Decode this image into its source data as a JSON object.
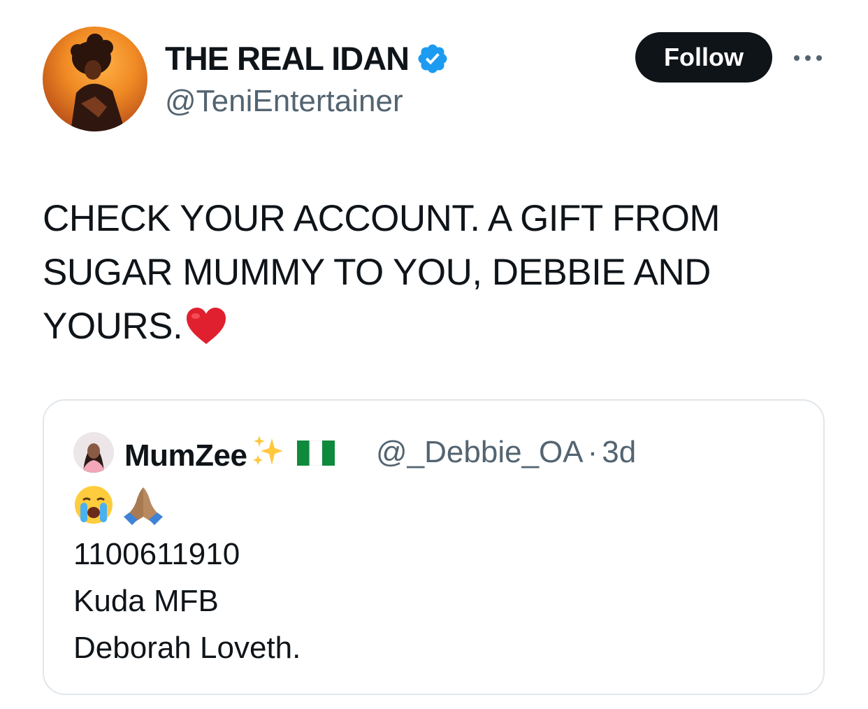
{
  "author": {
    "display_name": "THE REAL IDAN",
    "handle": "@TeniEntertainer",
    "verified": true
  },
  "actions": {
    "follow_label": "Follow"
  },
  "tweet": {
    "lines": [
      "CHECK YOUR ACCOUNT. A GIFT FROM",
      "SUGAR MUMMY TO YOU, DEBBIE AND",
      "YOURS."
    ]
  },
  "quoted_tweet": {
    "display_name": "MumZee",
    "handle": "@_Debbie_OA",
    "separator": "·",
    "age": "3d",
    "lines": [
      "1100611910",
      "Kuda MFB",
      "Deborah Loveth."
    ]
  },
  "colors": {
    "text": "#0f1419",
    "secondary": "#536471",
    "verified_blue": "#1d9bf0",
    "follow_bg": "#0f1419",
    "border": "#e1e6ea"
  }
}
